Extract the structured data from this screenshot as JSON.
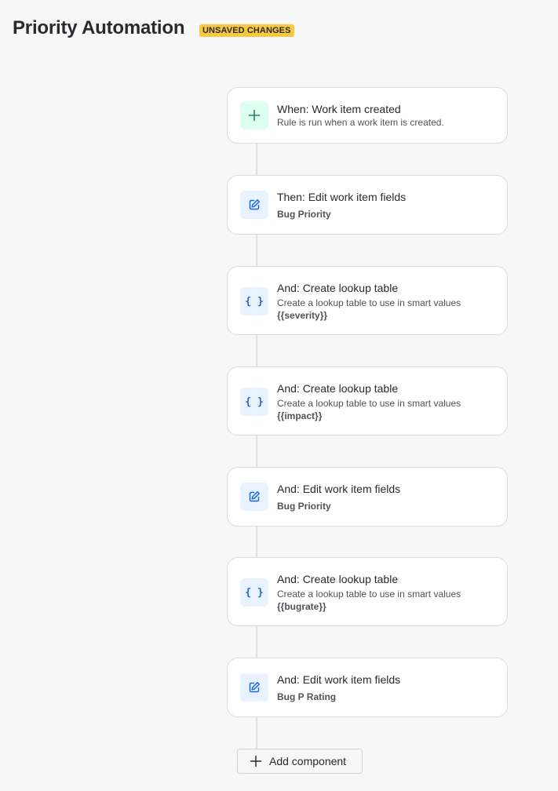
{
  "header": {
    "title": "Priority Automation",
    "badge": "UNSAVED CHANGES"
  },
  "components": [
    {
      "title": "When: Work item created",
      "desc": "Rule is run when a work item is created.",
      "icon": "plus-icon"
    },
    {
      "title": "Then: Edit work item fields",
      "bold": "Bug Priority",
      "icon": "edit-icon"
    },
    {
      "title": "And: Create lookup table",
      "desc": "Create a lookup table to use in smart values",
      "bold": "{{severity}}",
      "icon": "braces-icon",
      "glyph": "{ }"
    },
    {
      "title": "And: Create lookup table",
      "desc": "Create a lookup table to use in smart values",
      "bold": "{{impact}}",
      "icon": "braces-icon",
      "glyph": "{ }"
    },
    {
      "title": "And: Edit work item fields",
      "bold": "Bug Priority",
      "icon": "edit-icon"
    },
    {
      "title": "And: Create lookup table",
      "desc": "Create a lookup table to use in smart values",
      "bold": "{{bugrate}}",
      "icon": "braces-icon",
      "glyph": "{ }"
    },
    {
      "title": "And: Edit work item fields",
      "bold": "Bug P Rating",
      "icon": "edit-icon"
    }
  ],
  "add_button": {
    "label": "Add component",
    "icon": "plus-icon"
  },
  "colors": {
    "badge": "#f8c83f",
    "trigger_icon_bg": "#dcfff1",
    "trigger_icon": "#1f845a",
    "action_icon_bg": "#e9f2ff",
    "action_icon": "#1868db"
  }
}
